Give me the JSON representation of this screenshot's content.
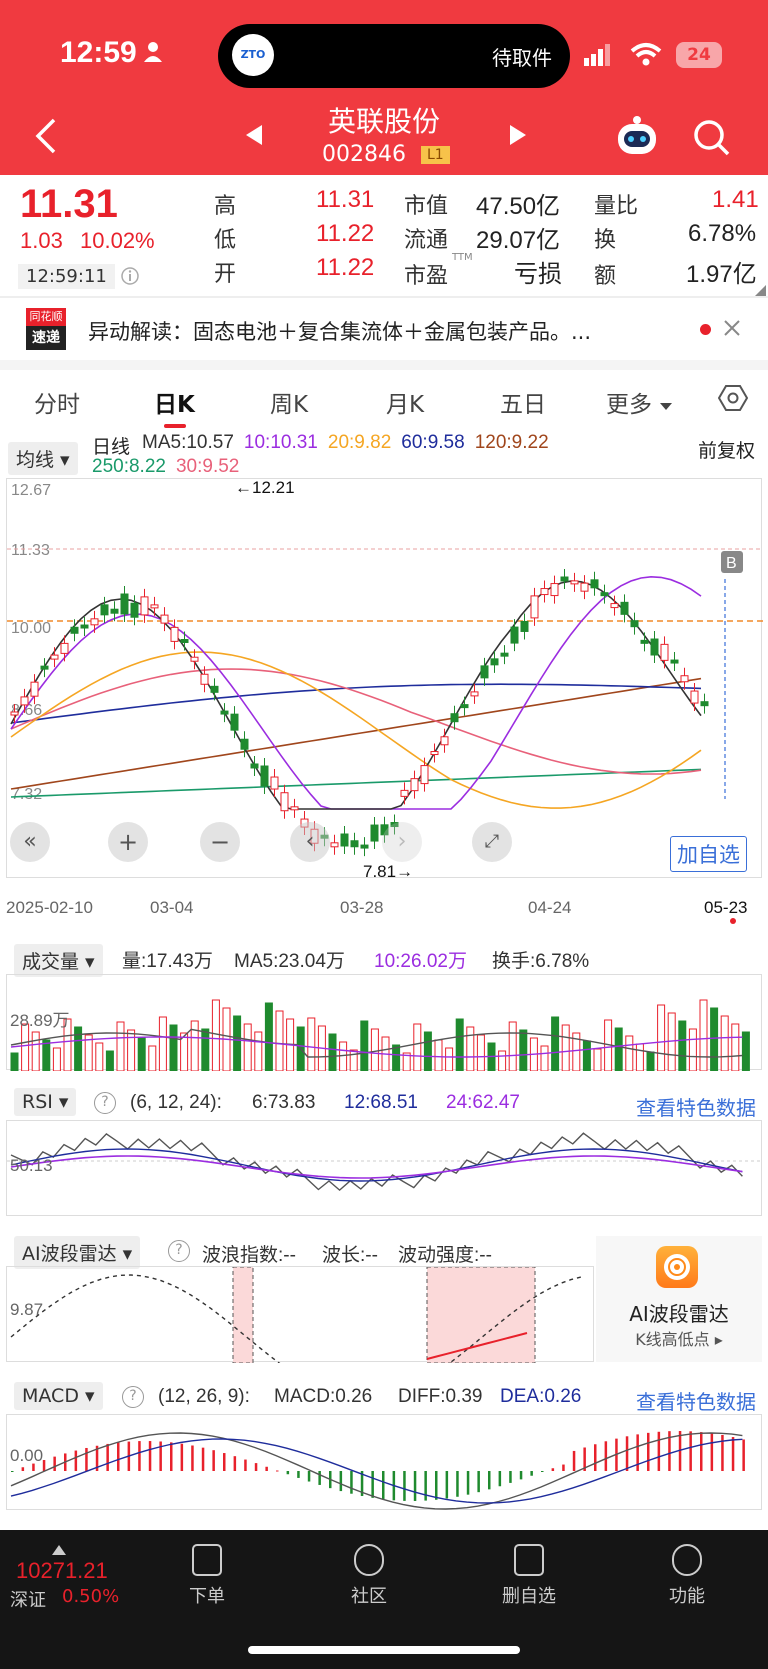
{
  "status_bar": {
    "time": "12:59",
    "island_text": "待取件",
    "island_logo": "ZTO",
    "battery": "24"
  },
  "header": {
    "title": "英联股份",
    "code": "002846",
    "badge": "L1"
  },
  "quote": {
    "price": "11.31",
    "change": "1.03",
    "change_pct": "10.02%",
    "time": "12:59:11",
    "labels": {
      "high": "高",
      "low": "低",
      "open": "开",
      "mcap": "市值",
      "float": "流通",
      "pe": "市盈",
      "pe_sup": "TTM",
      "vol_ratio": "量比",
      "turnover": "换",
      "amount": "额"
    },
    "high": "11.31",
    "low": "11.22",
    "open": "11.22",
    "mcap": "47.50亿",
    "float": "29.07亿",
    "pe": "亏损",
    "vol_ratio": "1.41",
    "turnover": "6.78%",
    "amount": "1.97亿"
  },
  "news": {
    "logo_top": "同花顺",
    "logo_bottom": "速递",
    "text": "异动解读：固态电池＋复合集流体＋金属包装产品。..."
  },
  "tabs": [
    "分时",
    "日K",
    "周K",
    "月K",
    "五日",
    "更多"
  ],
  "active_tab": "日K",
  "kline": {
    "dropdown": "均线",
    "period": "日线",
    "adjust": "前复权",
    "ma": [
      {
        "label": "MA5:10.57",
        "color": "#333333"
      },
      {
        "label": "10:10.31",
        "color": "#9b2de0"
      },
      {
        "label": "20:9.82",
        "color": "#f5a623"
      },
      {
        "label": "60:9.58",
        "color": "#1f2d9c"
      },
      {
        "label": "120:9.22",
        "color": "#a0461c"
      },
      {
        "label": "250:8.22",
        "color": "#1a9a6a"
      },
      {
        "label": "30:9.52",
        "color": "#e8617a"
      }
    ],
    "y_labels": [
      "12.67",
      "11.33",
      "10.00",
      "8.66",
      "7.32"
    ],
    "high_note": "←12.21",
    "low_note": "7.81→",
    "x_labels": [
      "2025-02-10",
      "03-04",
      "03-28",
      "04-24",
      "05-23"
    ],
    "add_btn": "加自选",
    "b_mark": "B"
  },
  "volume": {
    "dropdown": "成交量",
    "vol": "量:17.43万",
    "ma5": "MA5:23.04万",
    "ma10": "10:26.02万",
    "turnover": "换手:6.78%",
    "y_label": "28.89万"
  },
  "rsi": {
    "dropdown": "RSI",
    "params": "(6, 12, 24):",
    "r6": "6:73.83",
    "r12": "12:68.51",
    "r24": "24:62.47",
    "link": "查看特色数据",
    "y_label": "50.13"
  },
  "ai": {
    "dropdown": "AI波段雷达",
    "wave": "波浪指数:--",
    "len": "波长:--",
    "strength": "波动强度:--",
    "y_label": "9.87",
    "card_title": "AI波段雷达",
    "card_sub": "K线高低点 ▸"
  },
  "macd": {
    "dropdown": "MACD",
    "params": "(12, 26, 9):",
    "macd": "MACD:0.26",
    "diff": "DIFF:0.39",
    "dea": "DEA:0.26",
    "link": "查看特色数据",
    "y_label": "0.00"
  },
  "bottom": {
    "index_value": "10271.21",
    "index_name": "深证",
    "index_pct": "0.50%",
    "items": [
      "下单",
      "社区",
      "删自选",
      "功能"
    ]
  },
  "colors": {
    "up": "#e8212b",
    "down": "#1f8a2e",
    "accent": "#f03a40"
  }
}
